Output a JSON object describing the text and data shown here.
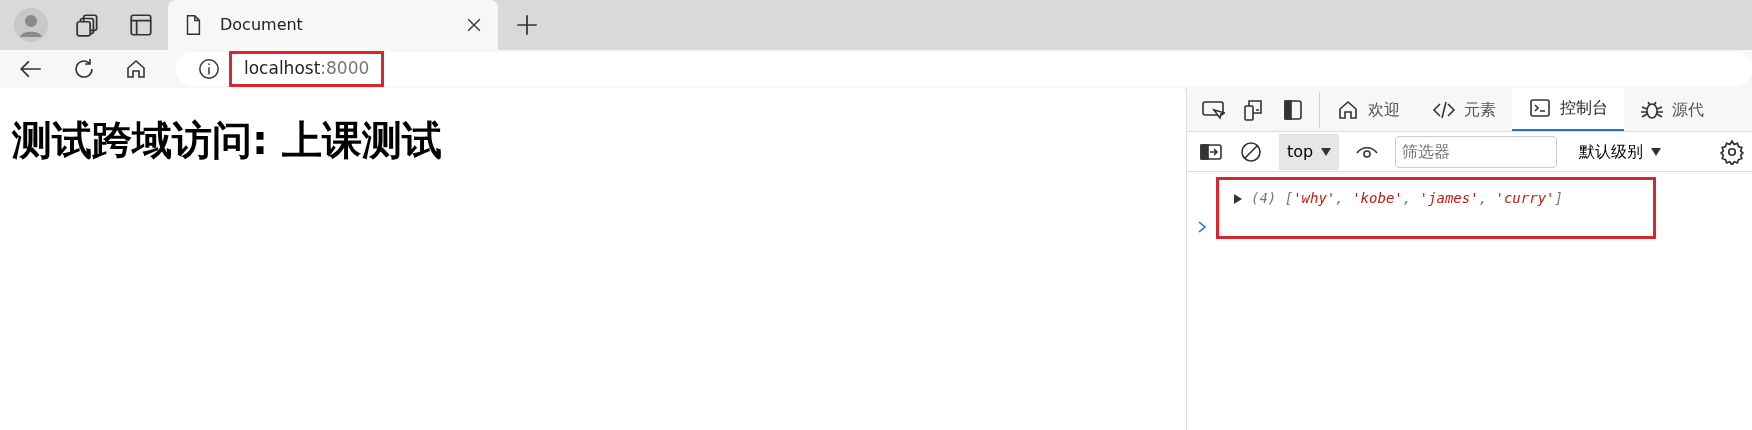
{
  "browser_tabs": [
    {
      "title": "Document",
      "selected": true
    }
  ],
  "address_bar": {
    "host": "localhost",
    "port": ":8000",
    "highlighted": true
  },
  "page": {
    "heading": "测试跨域访问: 上课测试"
  },
  "devtools": {
    "tabs": [
      {
        "label": "欢迎",
        "kind": "home",
        "selected": false
      },
      {
        "label": "元素",
        "kind": "code",
        "selected": false
      },
      {
        "label": "控制台",
        "kind": "console",
        "selected": true
      },
      {
        "label": "源代",
        "kind": "bug",
        "selected": false
      }
    ],
    "context": "top",
    "filter": {
      "placeholder": "筛选器"
    },
    "levels": "默认级别",
    "console": {
      "highlighted": true,
      "messages": [
        {
          "expanded": false,
          "count": "(4)",
          "parts": [
            {
              "kind": "punct",
              "text": "["
            },
            {
              "kind": "string",
              "text": "'why'"
            },
            {
              "kind": "punct",
              "text": ", "
            },
            {
              "kind": "string",
              "text": "'kobe'"
            },
            {
              "kind": "punct",
              "text": ", "
            },
            {
              "kind": "string",
              "text": "'james'"
            },
            {
              "kind": "punct",
              "text": ", "
            },
            {
              "kind": "string",
              "text": "'curry'"
            },
            {
              "kind": "punct",
              "text": "]"
            }
          ]
        }
      ]
    }
  }
}
